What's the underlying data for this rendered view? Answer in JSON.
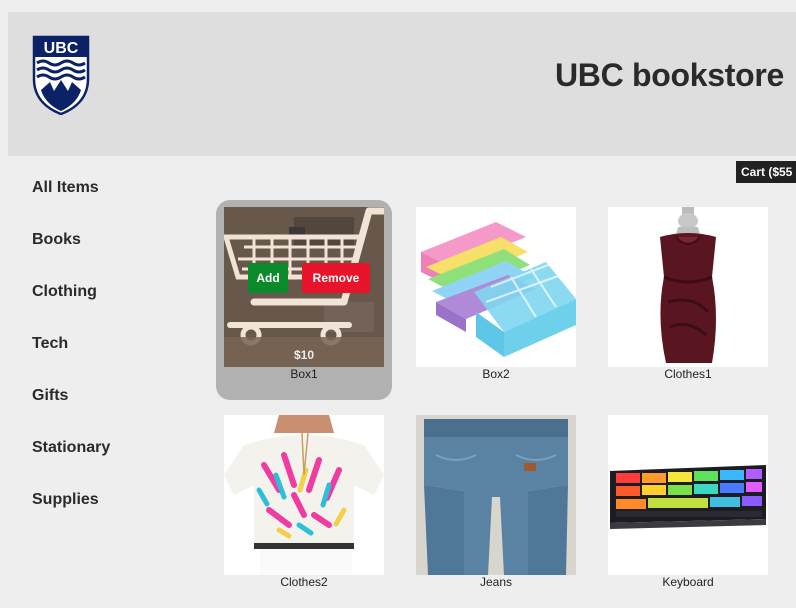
{
  "header": {
    "logo_text": "UBC",
    "title": "UBC bookstore"
  },
  "cart": {
    "label": "Cart ($55"
  },
  "sidebar": {
    "items": [
      {
        "label": "All Items"
      },
      {
        "label": "Books"
      },
      {
        "label": "Clothing"
      },
      {
        "label": "Tech"
      },
      {
        "label": "Gifts"
      },
      {
        "label": "Stationary"
      },
      {
        "label": "Supplies"
      }
    ]
  },
  "products": [
    {
      "name": "Box1",
      "price": "$10",
      "add_label": "Add",
      "remove_label": "Remove",
      "icon": "cart-icon"
    },
    {
      "name": "Box2",
      "icon": "storage-box-image"
    },
    {
      "name": "Clothes1",
      "icon": "dress-image"
    },
    {
      "name": "Clothes2",
      "icon": "blouse-image"
    },
    {
      "name": "Jeans",
      "icon": "jeans-image"
    },
    {
      "name": "Keyboard",
      "icon": "keyboard-image"
    }
  ],
  "colors": {
    "header_bg": "#dedede",
    "page_bg": "#eeeeee",
    "ubc_blue": "#0c2267",
    "add_green": "#0a8a2a",
    "remove_red": "#e8142c"
  }
}
